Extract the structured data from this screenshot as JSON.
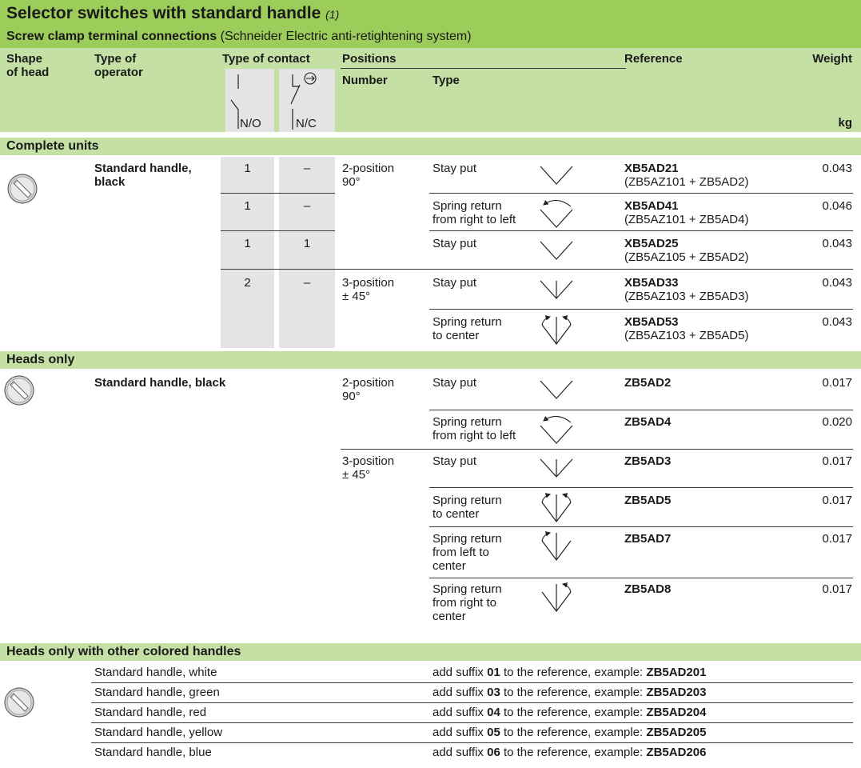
{
  "title": "Selector switches with standard handle",
  "title_note": "(1)",
  "subtitle_bold": "Screw clamp terminal connections",
  "subtitle_rest": " (Schneider Electric anti-retightening system)",
  "headers": {
    "shape": "Shape",
    "shape2": "of head",
    "operator": "Type of",
    "operator2": "operator",
    "contact": "Type of contact",
    "positions": "Positions",
    "number": "Number",
    "type": "Type",
    "reference": "Reference",
    "weight": "Weight",
    "kg": "kg",
    "no": "N/O",
    "nc": "N/C"
  },
  "complete": {
    "label": "Complete units",
    "operator_line1": "Standard handle,",
    "operator_line2": "black",
    "rows": [
      {
        "no": "1",
        "nc": "–",
        "type1": "Stay put",
        "type2": "",
        "ref": "XB5AD21",
        "sub": "(ZB5AZ101 + ZB5AD2)",
        "weight": "0.043"
      },
      {
        "no": "1",
        "nc": "–",
        "type1": "Spring return",
        "type2": "from right to left",
        "ref": "XB5AD41",
        "sub": "(ZB5AZ101 + ZB5AD4)",
        "weight": "0.046"
      },
      {
        "no": "1",
        "nc": "1",
        "type1": "Stay put",
        "type2": "",
        "ref": "XB5AD25",
        "sub": "(ZB5AZ105 + ZB5AD2)",
        "weight": "0.043"
      },
      {
        "no": "2",
        "nc": "–",
        "type1": "Stay put",
        "type2": "",
        "ref": "XB5AD33",
        "sub": "(ZB5AZ103 + ZB5AD3)",
        "weight": "0.043"
      },
      {
        "no": "",
        "nc": "",
        "type1": "Spring return",
        "type2": "to center",
        "ref": "XB5AD53",
        "sub": "(ZB5AZ103 + ZB5AD5)",
        "weight": "0.043"
      }
    ],
    "pos2_line1": "2-position",
    "pos2_line2": "90°",
    "pos3_line1": "3-position",
    "pos3_line2": "± 45°"
  },
  "heads": {
    "label": "Heads only",
    "operator": "Standard handle, black",
    "pos2_line1": "2-position",
    "pos2_line2": "90°",
    "pos3_line1": "3-position",
    "pos3_line2": "± 45°",
    "rows": [
      {
        "t1": "Stay put",
        "t2": "",
        "t3": "",
        "ref": "ZB5AD2",
        "weight": "0.017"
      },
      {
        "t1": "Spring return",
        "t2": "from right to left",
        "t3": "",
        "ref": "ZB5AD4",
        "weight": "0.020"
      },
      {
        "t1": "Stay put",
        "t2": "",
        "t3": "",
        "ref": "ZB5AD3",
        "weight": "0.017"
      },
      {
        "t1": "Spring return",
        "t2": "to center",
        "t3": "",
        "ref": "ZB5AD5",
        "weight": "0.017"
      },
      {
        "t1": "Spring return",
        "t2": "from left to",
        "t3": "center",
        "ref": "ZB5AD7",
        "weight": "0.017"
      },
      {
        "t1": "Spring return",
        "t2": "from right to",
        "t3": "center",
        "ref": "ZB5AD8",
        "weight": "0.017"
      }
    ]
  },
  "colored": {
    "label": "Heads only with other colored handles",
    "prefix": "add suffix ",
    "middle": " to the reference, example: ",
    "rows": [
      {
        "handle": "Standard handle, white",
        "suffix": "01",
        "example": "ZB5AD201"
      },
      {
        "handle": "Standard handle, green",
        "suffix": "03",
        "example": "ZB5AD203"
      },
      {
        "handle": "Standard handle, red",
        "suffix": "04",
        "example": "ZB5AD204"
      },
      {
        "handle": "Standard handle, yellow",
        "suffix": "05",
        "example": "ZB5AD205"
      },
      {
        "handle": "Standard handle, blue",
        "suffix": "06",
        "example": "ZB5AD206"
      }
    ]
  },
  "colors": {
    "header_green": "#9ccc5a",
    "light_green": "#c5e0a5",
    "contact_gray": "#e4e4e4"
  },
  "icons": [
    "selector-head-icon",
    "stay-put-2pos-icon",
    "spring-return-right-left-icon",
    "stay-put-3pos-icon",
    "spring-return-center-icon",
    "spring-return-left-center-icon",
    "spring-return-right-center-icon",
    "no-contact-icon",
    "nc-contact-icon"
  ]
}
